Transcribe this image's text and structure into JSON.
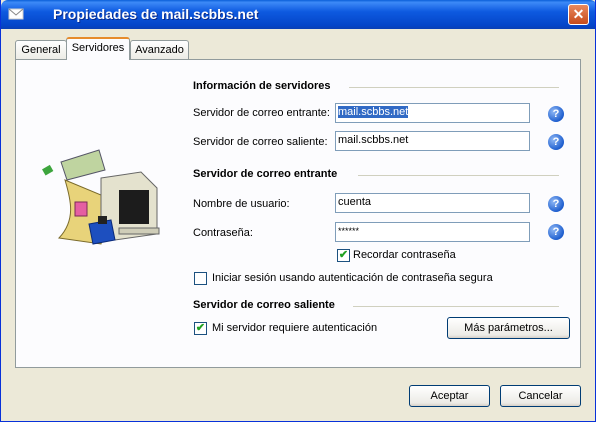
{
  "window": {
    "title": "Propiedades de mail.scbbs.net",
    "close_label": "✕"
  },
  "tabs": [
    {
      "label": "General"
    },
    {
      "label": "Servidores"
    },
    {
      "label": "Avanzado"
    }
  ],
  "servers_section": {
    "heading": "Información de servidores",
    "incoming_label": "Servidor de correo entrante:",
    "incoming_value": "mail.scbbs.net",
    "outgoing_label": "Servidor de correo saliente:",
    "outgoing_value": "mail.scbbs.net"
  },
  "incoming_section": {
    "heading": "Servidor de correo entrante",
    "username_label": "Nombre de usuario:",
    "username_value": "cuenta",
    "password_label": "Contraseña:",
    "password_value": "******",
    "remember_password_label": "Recordar contraseña",
    "remember_password_checked": true,
    "spa_label": "Iniciar sesión usando autenticación de contraseña segura",
    "spa_checked": false
  },
  "outgoing_section": {
    "heading": "Servidor de correo saliente",
    "requires_auth_label": "Mi servidor requiere autenticación",
    "requires_auth_checked": true,
    "more_settings_label": "Más parámetros..."
  },
  "footer": {
    "ok_label": "Aceptar",
    "cancel_label": "Cancelar"
  },
  "help_glyph": "?",
  "check_glyph": "✔",
  "colors": {
    "titlebar": "#0a5fd8",
    "selection": "#316ac5",
    "active_tab_accent": "#e68b2c"
  }
}
